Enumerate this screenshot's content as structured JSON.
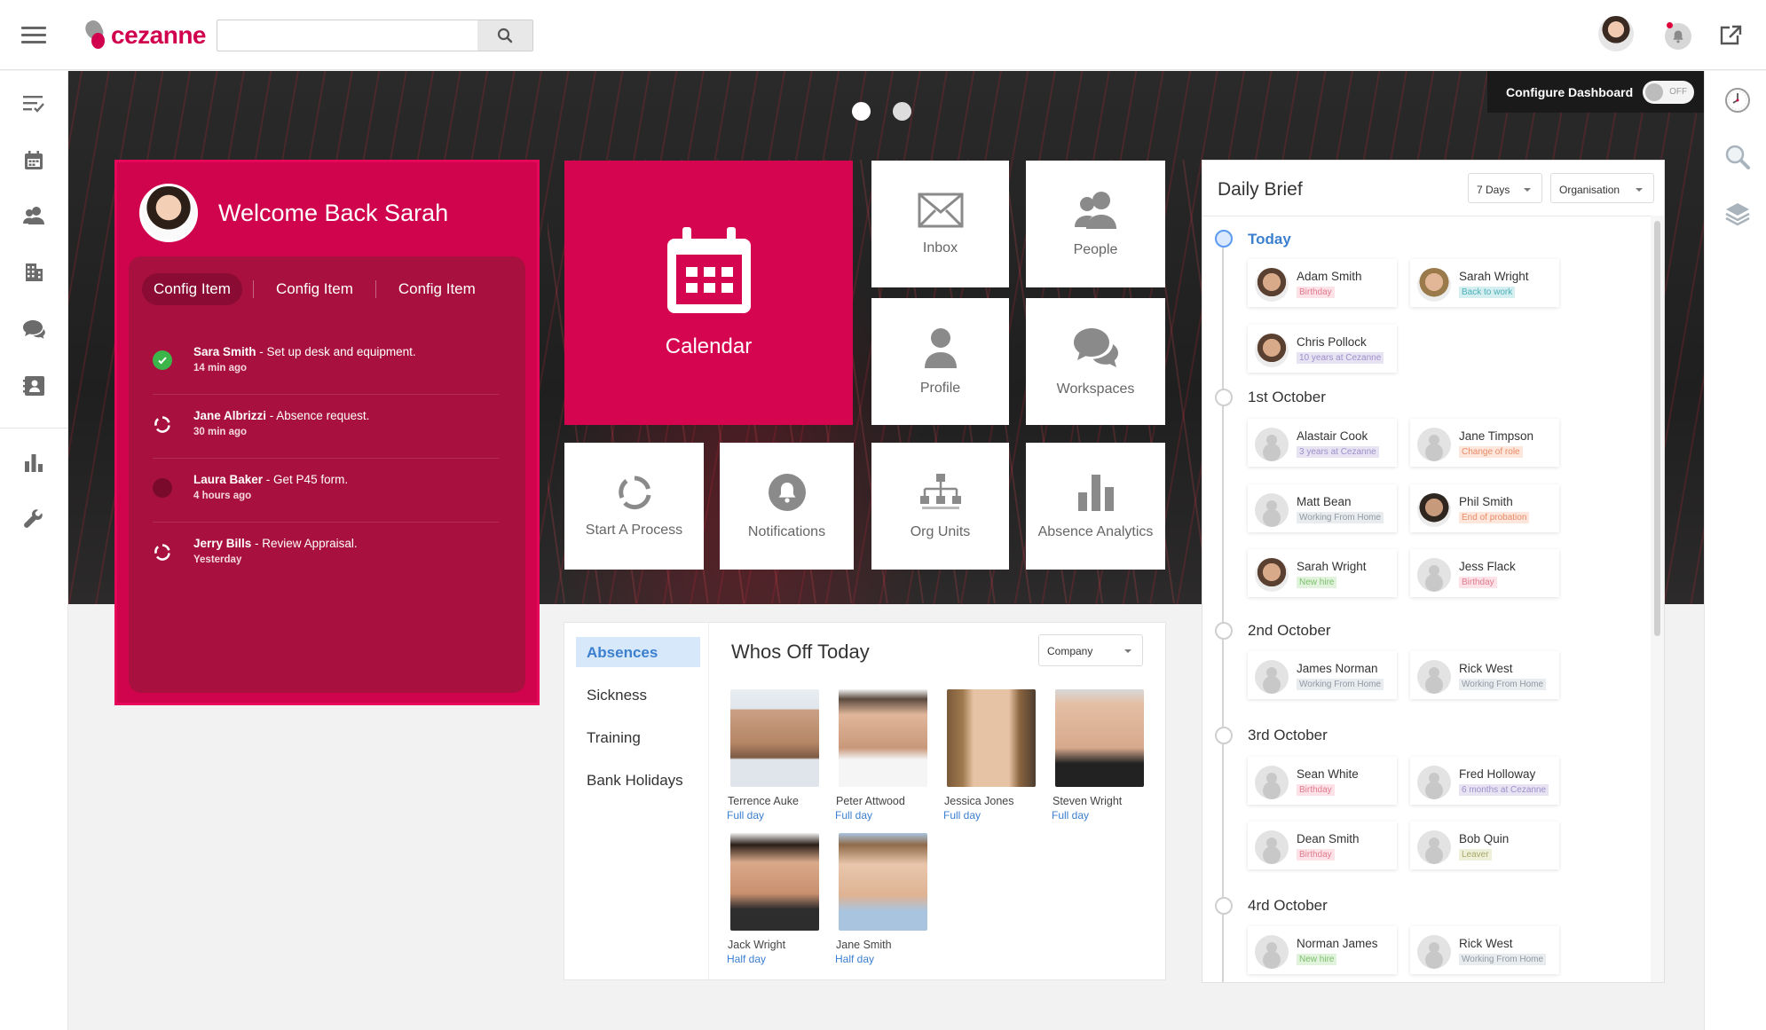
{
  "app": {
    "brand": "cezanne",
    "search_placeholder": ""
  },
  "configure_dashboard": {
    "label": "Configure Dashboard",
    "toggle": "OFF"
  },
  "welcome": {
    "title": "Welcome Back Sarah",
    "tabs": [
      "Config Item",
      "Config Item",
      "Config Item"
    ],
    "tasks": [
      {
        "name": "Sara Smith",
        "text": " - Set up desk and equipment.",
        "time": "14 min ago",
        "status": "done"
      },
      {
        "name": "Jane Albrizzi",
        "text": " - Absence request.",
        "time": "30 min ago",
        "status": "in-progress"
      },
      {
        "name": "Laura Baker",
        "text": " - Get P45 form.",
        "time": "4 hours ago",
        "status": "pending"
      },
      {
        "name": "Jerry Bills",
        "text": " - Review Appraisal.",
        "time": "Yesterday",
        "status": "in-progress"
      }
    ]
  },
  "tiles": {
    "calendar": "Calendar",
    "inbox": "Inbox",
    "people": "People",
    "profile": "Profile",
    "workspaces": "Workspaces",
    "start_process": "Start A Process",
    "notifications": "Notifications",
    "org_units": "Org Units",
    "absence_analytics": "Absence Analytics"
  },
  "whos_off": {
    "title": "Whos Off Today",
    "filter": "Company",
    "nav": [
      "Absences",
      "Sickness",
      "Training",
      "Bank Holidays"
    ],
    "people": [
      {
        "name": "Terrence Auke",
        "duration": "Full day"
      },
      {
        "name": "Peter Attwood",
        "duration": "Full day"
      },
      {
        "name": "Jessica Jones",
        "duration": "Full day"
      },
      {
        "name": "Steven Wright",
        "duration": "Full day"
      },
      {
        "name": "Jack Wright",
        "duration": "Half day"
      },
      {
        "name": "Jane Smith",
        "duration": "Half day"
      }
    ]
  },
  "daily_brief": {
    "title": "Daily Brief",
    "period": "7 Days",
    "scope": "Organisation",
    "days": [
      {
        "label": "Today",
        "entries": [
          {
            "name": "Adam Smith",
            "tag": "Birthday",
            "tone": "pink"
          },
          {
            "name": "Sarah Wright",
            "tag": "Back to work",
            "tone": "teal"
          },
          {
            "name": "Chris Pollock",
            "tag": "10 years at Cezanne",
            "tone": "purple"
          }
        ]
      },
      {
        "label": "1st October",
        "entries": [
          {
            "name": "Alastair Cook",
            "tag": "3 years at Cezanne",
            "tone": "purple"
          },
          {
            "name": "Jane Timpson",
            "tag": "Change of role",
            "tone": "orange"
          },
          {
            "name": "Matt Bean",
            "tag": "Working From Home",
            "tone": "grey"
          },
          {
            "name": "Phil Smith",
            "tag": "End of probation",
            "tone": "orange"
          },
          {
            "name": "Sarah Wright",
            "tag": "New hire",
            "tone": "green"
          },
          {
            "name": "Jess Flack",
            "tag": "Birthday",
            "tone": "pink"
          }
        ]
      },
      {
        "label": "2nd October",
        "entries": [
          {
            "name": "James Norman",
            "tag": "Working From Home",
            "tone": "grey"
          },
          {
            "name": "Rick West",
            "tag": "Working From Home",
            "tone": "grey"
          }
        ]
      },
      {
        "label": "3rd October",
        "entries": [
          {
            "name": "Sean White",
            "tag": "Birthday",
            "tone": "pink"
          },
          {
            "name": "Fred Holloway",
            "tag": "6 months at Cezanne",
            "tone": "purple"
          },
          {
            "name": "Dean Smith",
            "tag": "Birthday",
            "tone": "pink"
          },
          {
            "name": "Bob Quin",
            "tag": "Leaver",
            "tone": "olive"
          }
        ]
      },
      {
        "label": "4rd October",
        "entries": [
          {
            "name": "Norman James",
            "tag": "New hire",
            "tone": "green"
          },
          {
            "name": "Rick West",
            "tag": "Working From Home",
            "tone": "grey"
          }
        ]
      }
    ]
  }
}
